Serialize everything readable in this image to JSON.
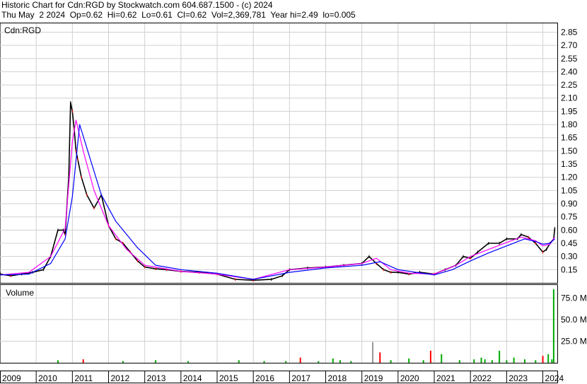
{
  "header": {
    "title": "Historic Chart for Cdn:RGD by Stockwatch.com 604.687.1500 - (c) 2024",
    "quote": "Thu May  2 2024  Op=0.62  Hi=0.62  Lo=0.61  Cl=0.62  Vol=2,369,781  Year hi=2.49  lo=0.005"
  },
  "colors": {
    "price_up": "#000000",
    "price_down": "#ff0000",
    "ma_fast": "#ff00ff",
    "ma_slow": "#0000ff",
    "vol_up": "#00aa00",
    "vol_down": "#ff0000",
    "vol_neutral": "#999999",
    "grid": "#d0d0d0"
  },
  "chart_data": [
    {
      "type": "line",
      "symbol": "Cdn:RGD",
      "xlim": [
        2009.0,
        2024.4
      ],
      "ylim": [
        0,
        2.95
      ],
      "y_ticks": [
        "2.85",
        "2.70",
        "2.55",
        "2.40",
        "2.25",
        "2.10",
        "1.95",
        "1.80",
        "1.65",
        "1.50",
        "1.35",
        "1.20",
        "1.05",
        "0.90",
        "0.75",
        "0.60",
        "0.45",
        "0.30",
        "0.15"
      ],
      "x_ticks": [
        "2009",
        "2010",
        "2011",
        "2012",
        "2013",
        "2014",
        "2015",
        "2016",
        "2017",
        "2018",
        "2019",
        "2020",
        "2021",
        "2022",
        "2023",
        "2024"
      ],
      "grid": true,
      "series": [
        {
          "kind": "price",
          "x": [
            2009.0,
            2009.3,
            2009.6,
            2009.9,
            2010.2,
            2010.4,
            2010.6,
            2010.75,
            2010.8,
            2010.9,
            2010.95,
            2011.0,
            2011.05,
            2011.1,
            2011.15,
            2011.25,
            2011.4,
            2011.6,
            2011.8,
            2012.0,
            2012.2,
            2012.4,
            2012.6,
            2012.8,
            2013.0,
            2013.3,
            2013.6,
            2014.0,
            2014.5,
            2015.0,
            2015.5,
            2016.0,
            2016.5,
            2016.8,
            2017.0,
            2017.5,
            2018.0,
            2018.5,
            2019.0,
            2019.2,
            2019.4,
            2019.6,
            2019.8,
            2020.0,
            2020.3,
            2020.6,
            2021.0,
            2021.3,
            2021.6,
            2021.8,
            2022.0,
            2022.2,
            2022.5,
            2022.8,
            2023.0,
            2023.3,
            2023.4,
            2023.6,
            2023.8,
            2024.0,
            2024.1,
            2024.2,
            2024.3,
            2024.33
          ],
          "y": [
            0.1,
            0.08,
            0.1,
            0.12,
            0.15,
            0.3,
            0.6,
            0.6,
            0.55,
            1.2,
            2.05,
            1.95,
            1.75,
            1.5,
            1.4,
            1.2,
            1.0,
            0.85,
            1.0,
            0.65,
            0.5,
            0.45,
            0.35,
            0.25,
            0.18,
            0.16,
            0.15,
            0.13,
            0.12,
            0.1,
            0.04,
            0.03,
            0.04,
            0.08,
            0.15,
            0.17,
            0.18,
            0.2,
            0.22,
            0.3,
            0.22,
            0.15,
            0.12,
            0.12,
            0.1,
            0.12,
            0.1,
            0.15,
            0.2,
            0.3,
            0.28,
            0.35,
            0.45,
            0.45,
            0.5,
            0.5,
            0.55,
            0.52,
            0.45,
            0.35,
            0.38,
            0.45,
            0.5,
            0.62
          ]
        },
        {
          "kind": "moving-average-fast",
          "x": [
            2009.0,
            2009.8,
            2010.4,
            2010.8,
            2011.0,
            2011.1,
            2011.3,
            2011.6,
            2012.0,
            2012.5,
            2013.0,
            2014.0,
            2015.0,
            2016.0,
            2017.0,
            2018.0,
            2019.0,
            2019.4,
            2019.8,
            2020.3,
            2021.0,
            2021.6,
            2022.0,
            2022.5,
            2023.0,
            2023.4,
            2023.8,
            2024.0,
            2024.2,
            2024.33
          ],
          "y": [
            0.09,
            0.12,
            0.3,
            0.62,
            1.6,
            1.85,
            1.5,
            1.05,
            0.65,
            0.38,
            0.2,
            0.13,
            0.1,
            0.04,
            0.15,
            0.18,
            0.22,
            0.28,
            0.15,
            0.11,
            0.1,
            0.2,
            0.3,
            0.38,
            0.46,
            0.52,
            0.48,
            0.42,
            0.44,
            0.52
          ]
        },
        {
          "kind": "moving-average-slow",
          "x": [
            2009.0,
            2009.8,
            2010.4,
            2010.8,
            2011.0,
            2011.2,
            2011.5,
            2011.8,
            2012.2,
            2012.8,
            2013.3,
            2014.0,
            2015.0,
            2016.0,
            2017.0,
            2018.0,
            2019.0,
            2019.5,
            2020.0,
            2020.5,
            2021.0,
            2021.5,
            2022.0,
            2022.5,
            2023.0,
            2023.5,
            2023.8,
            2024.0,
            2024.2,
            2024.33
          ],
          "y": [
            0.09,
            0.1,
            0.22,
            0.5,
            0.98,
            1.8,
            1.4,
            1.0,
            0.7,
            0.4,
            0.2,
            0.15,
            0.11,
            0.04,
            0.12,
            0.17,
            0.2,
            0.24,
            0.15,
            0.12,
            0.09,
            0.15,
            0.25,
            0.34,
            0.42,
            0.5,
            0.47,
            0.44,
            0.45,
            0.5
          ]
        }
      ]
    },
    {
      "type": "bar",
      "label": "Volume",
      "xlim": [
        2009.0,
        2024.4
      ],
      "ylim": [
        0,
        90
      ],
      "y_ticks": [
        "75.0 M",
        "50.0 M",
        "25.0 M"
      ],
      "x": [
        2010.6,
        2011.3,
        2012.4,
        2013.3,
        2014.2,
        2015.6,
        2016.3,
        2016.9,
        2017.3,
        2017.8,
        2018.2,
        2018.4,
        2018.7,
        2019.3,
        2019.5,
        2019.8,
        2020.3,
        2020.7,
        2020.9,
        2021.2,
        2021.7,
        2022.1,
        2022.3,
        2022.4,
        2022.6,
        2022.8,
        2023.0,
        2023.2,
        2023.5,
        2023.8,
        2024.0,
        2024.15,
        2024.25,
        2024.3
      ],
      "values": [
        3,
        4,
        2,
        3,
        2,
        3,
        2,
        2,
        6,
        2,
        5,
        3,
        2,
        24,
        12,
        3,
        5,
        3,
        14,
        10,
        3,
        4,
        6,
        4,
        3,
        14,
        3,
        6,
        4,
        3,
        8,
        10,
        4,
        85
      ],
      "colors": [
        "g",
        "r",
        "g",
        "g",
        "g",
        "g",
        "g",
        "g",
        "r",
        "g",
        "g",
        "g",
        "g",
        "n",
        "r",
        "g",
        "g",
        "g",
        "r",
        "g",
        "g",
        "g",
        "g",
        "g",
        "g",
        "g",
        "g",
        "g",
        "g",
        "g",
        "r",
        "g",
        "g",
        "g"
      ]
    }
  ]
}
